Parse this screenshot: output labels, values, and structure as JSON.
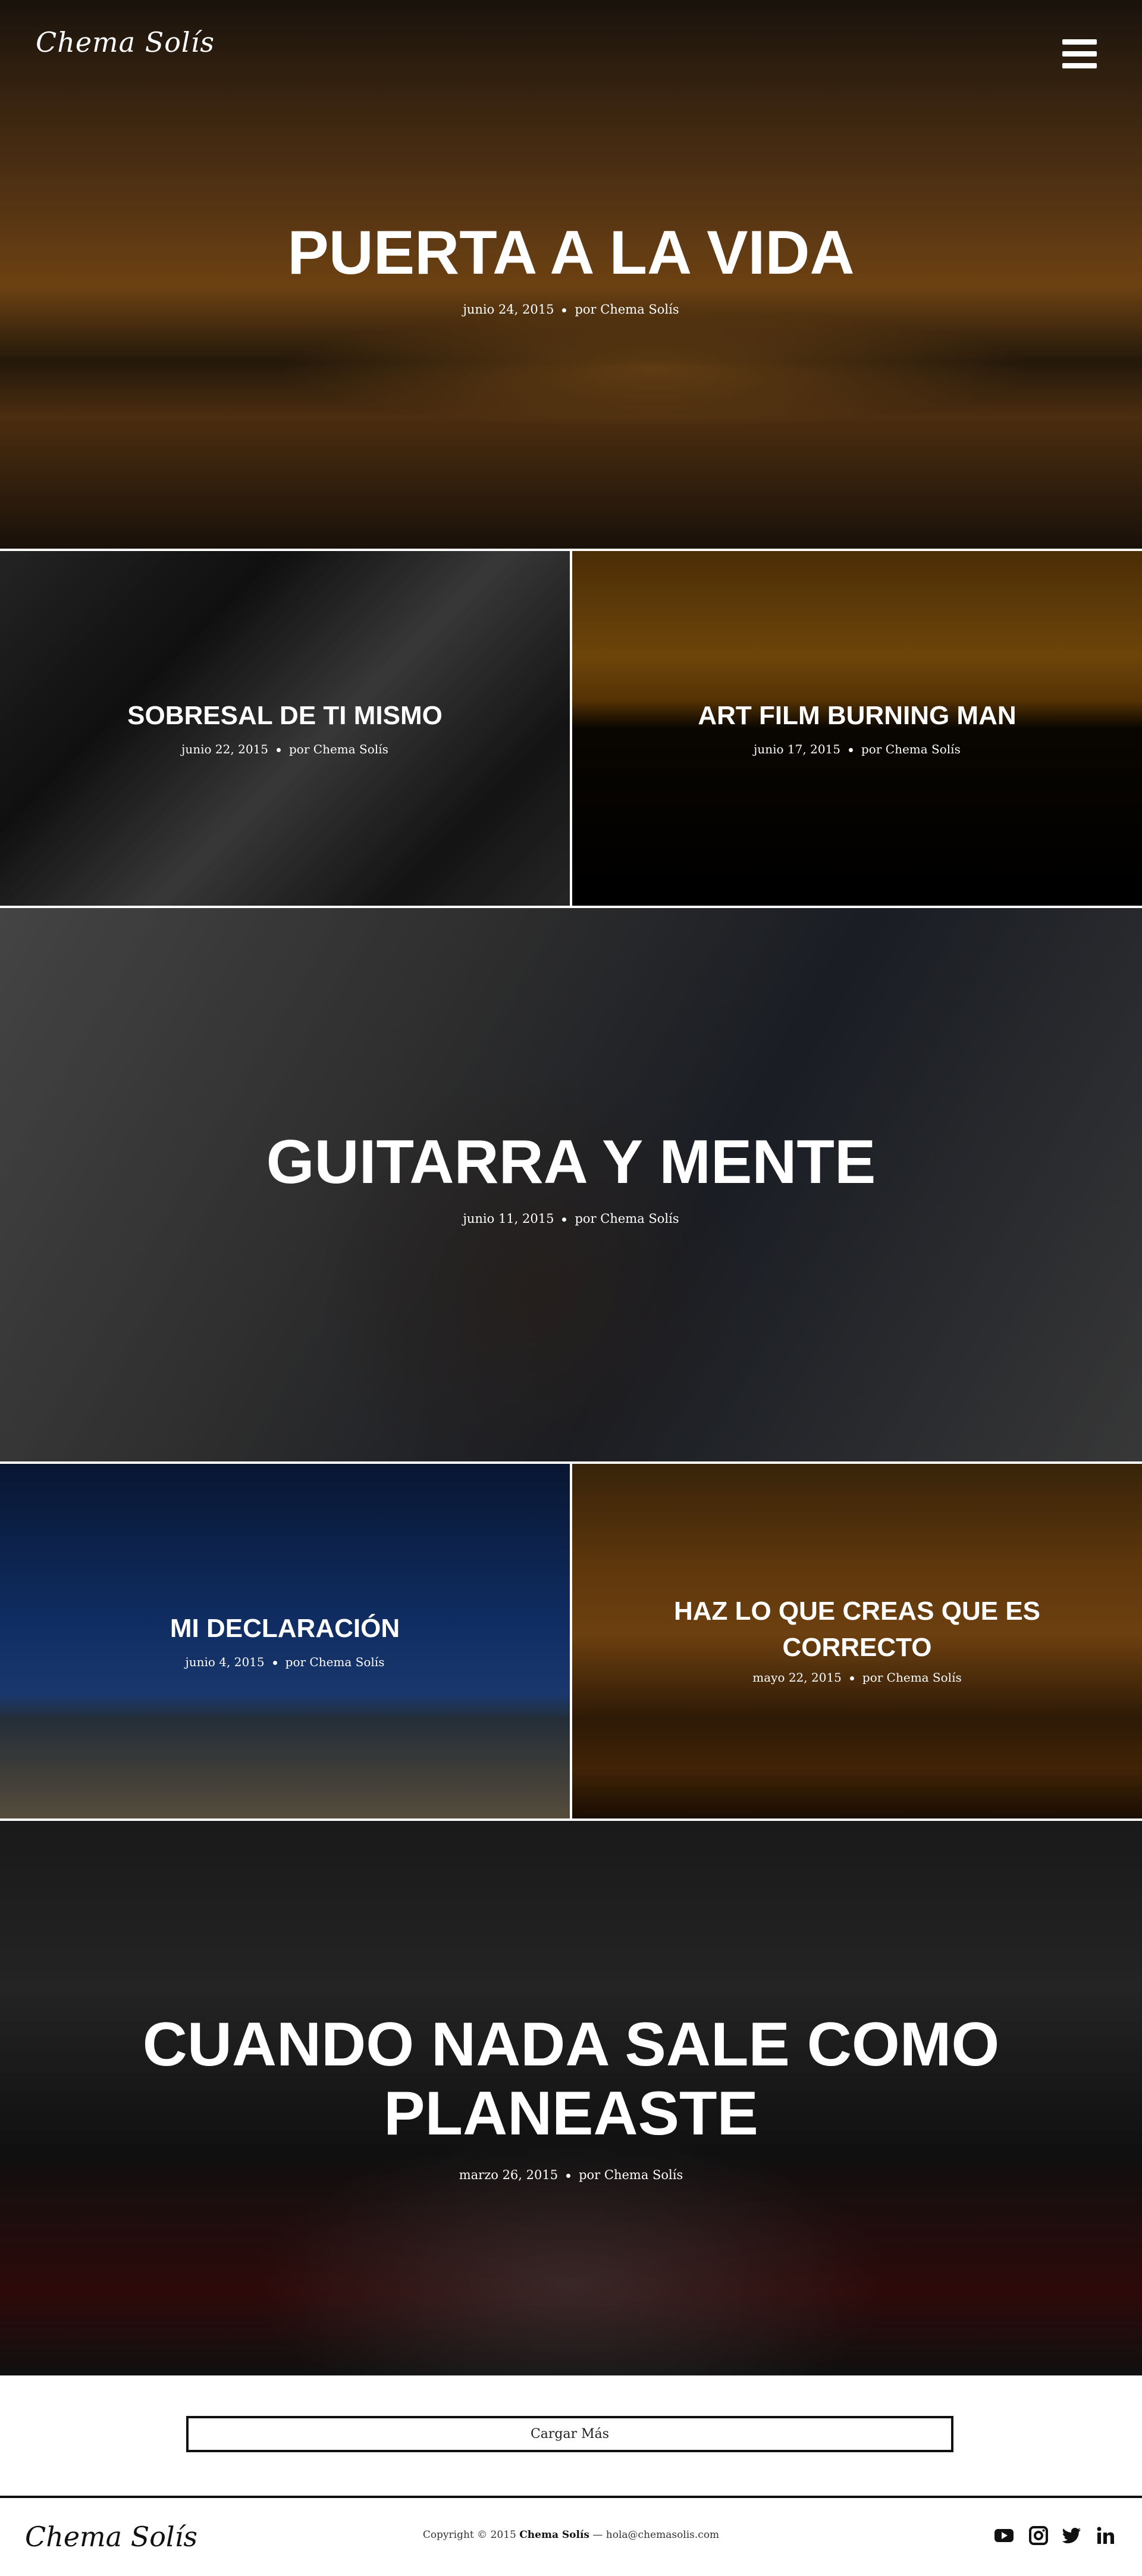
{
  "site": {
    "logo": "Chema Solís"
  },
  "nav": {
    "menu_icon": "hamburger-menu-icon"
  },
  "posts": [
    {
      "title": "PUERTA A LA VIDA",
      "date": "junio 24, 2015",
      "author": "por Chema Solís"
    },
    {
      "title": "SOBRESAL DE TI MISMO",
      "date": "junio 22, 2015",
      "author": "por Chema Solís"
    },
    {
      "title": "ART FILM BURNING MAN",
      "date": "junio 17, 2015",
      "author": "por Chema Solís"
    },
    {
      "title": "GUITARRA Y MENTE",
      "date": "junio 11, 2015",
      "author": "por Chema Solís"
    },
    {
      "title": "MI DECLARACIÓN",
      "date": "junio 4, 2015",
      "author": "por Chema Solís"
    },
    {
      "title": "HAZ LO QUE CREAS QUE ES CORRECTO",
      "date": "mayo 22, 2015",
      "author": "por Chema Solís"
    },
    {
      "title": "CUANDO NADA SALE COMO PLANEASTE",
      "date": "marzo 26, 2015",
      "author": "por Chema Solís"
    }
  ],
  "load_more": {
    "label": "Cargar Más"
  },
  "footer": {
    "logo": "Chema Solís",
    "copyright_prefix": "Copyright © 2015",
    "copyright_name": "Chema Solís",
    "copyright_sep": "—",
    "email": "hola@chemasolis.com",
    "social": [
      "youtube-icon",
      "instagram-icon",
      "twitter-icon",
      "linkedin-icon"
    ]
  }
}
